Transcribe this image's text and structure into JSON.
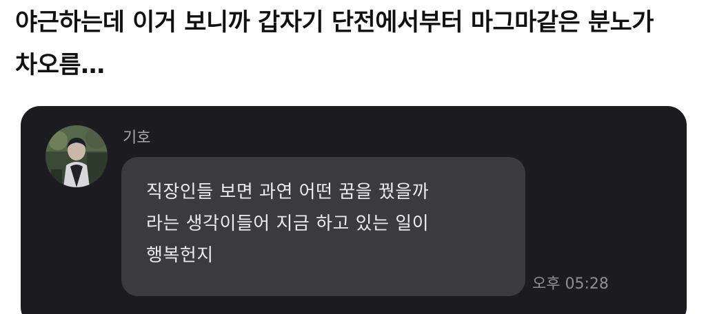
{
  "post": {
    "text": "야근하는데 이거 보니까 갑자기 단전에서부터 마그마같은 분노가 차오름…"
  },
  "chat": {
    "sender_name": "기호",
    "message_lines": [
      "직장인들 보면 과연 어떤 꿈을 꿨을까",
      "라는 생각이들어 지금 하고 있는 일이",
      "행복헌지"
    ],
    "timestamp": "오후 05:28",
    "avatar_icon": "profile-photo",
    "colors": {
      "card_background": "#1c1c20",
      "bubble_background": "#3a3a3f",
      "message_text": "#ececec",
      "meta_text": "#8e8e93"
    }
  }
}
